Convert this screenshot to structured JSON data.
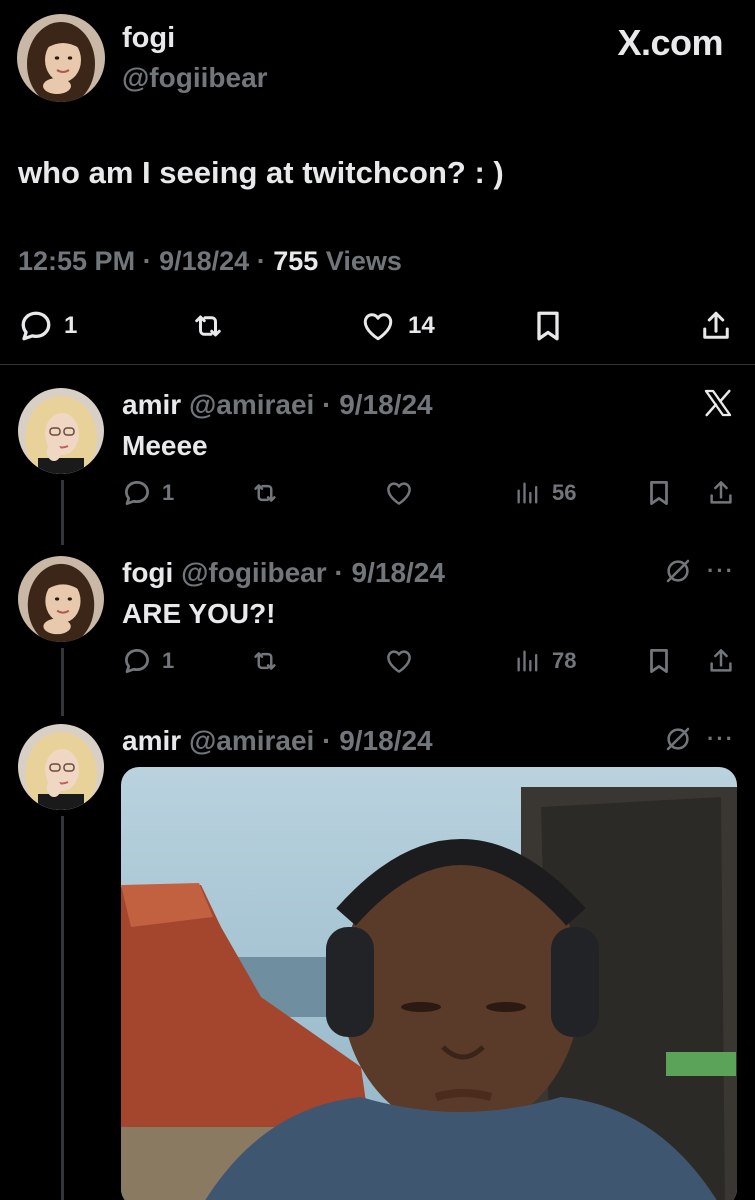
{
  "brand": "X.com",
  "main_post": {
    "author_name": "fogi",
    "author_handle": "@fogiibear",
    "text": "who am I seeing at twitchcon? : )",
    "time": "12:55 PM",
    "date": "9/18/24",
    "views_count": "755",
    "views_label": "Views",
    "separator": "·",
    "replies": "1",
    "likes": "14"
  },
  "replies": [
    {
      "name": "amir",
      "handle": "@amiraei",
      "date": "9/18/24",
      "text": "Meeee",
      "replies": "1",
      "views": "56",
      "corner_icon": "x-logo-icon"
    },
    {
      "name": "fogi",
      "handle": "@fogiibear",
      "date": "9/18/24",
      "text": "ARE YOU?!",
      "replies": "1",
      "views": "78",
      "corner_icon": "grok-icon"
    },
    {
      "name": "amir",
      "handle": "@amiraei",
      "date": "9/18/24",
      "text": "",
      "corner_icon": "grok-icon"
    }
  ],
  "colors": {
    "background": "#000000",
    "text_primary": "#e7e9ea",
    "text_secondary": "#71767b",
    "divider": "#2f3336",
    "thread_line": "#333639"
  },
  "more_glyph": "···"
}
